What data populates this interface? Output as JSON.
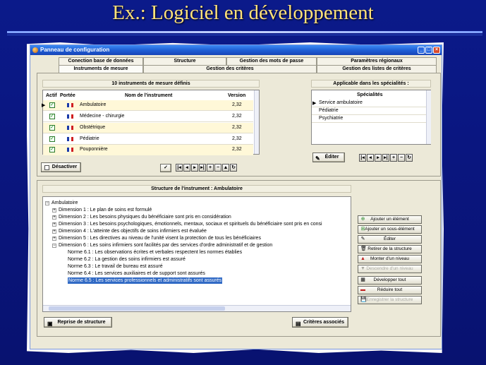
{
  "slide": {
    "title": "Ex.: Logiciel en développement"
  },
  "window": {
    "title": "Panneau de configuration",
    "min": "_",
    "max": "□",
    "close": "×"
  },
  "tabs_top": [
    "Conection base de données",
    "Structure",
    "Gestion des mots de passe",
    "Paramètres régionaux"
  ],
  "tabs_bottom": [
    "Instruments de mesure",
    "Gestion des critères",
    "Gestion des listes de critères"
  ],
  "instruments": {
    "title": "10 instruments de mesure définis",
    "headers": {
      "actif": "Actif",
      "portee": "Portée",
      "nom": "Nom de l'instrument",
      "version": "Version"
    },
    "rows": [
      {
        "name": "Ambulatoire",
        "version": "2,32"
      },
      {
        "name": "Médecine - chirurgie",
        "version": "2,32"
      },
      {
        "name": "Obstétrique",
        "version": "2,32"
      },
      {
        "name": "Pédiatrie",
        "version": "2,32"
      },
      {
        "name": "Pouponnière",
        "version": "2,32"
      }
    ],
    "deactivate_label": "Désactiver"
  },
  "specialties": {
    "title": "Applicable dans les spécialités :",
    "header": "Spécialités",
    "items": [
      "Service ambulatoire",
      "Pédiatrie",
      "Psychiatrie"
    ],
    "edit_label": "Éditer"
  },
  "nav_glyphs": {
    "first": "|◂",
    "prev": "◂",
    "next": "▸",
    "last": "▸|",
    "add": "+",
    "remove": "−",
    "up": "▲",
    "refresh": "↻",
    "ok": "✓"
  },
  "structure": {
    "title": "Structure de l'instrument : Ambulatoire",
    "root": "Ambulatoire",
    "dimensions": [
      "Dimension 1 : Le plan de soins est formulé",
      "Dimension 2 : Les besoins physiques du bénéficiaire sont pris en considération",
      "Dimension 3 : Les besoins psychologiques, émotionnels, mentaux, sociaux et spirituels du bénéficiaire sont pris en consi",
      "Dimension 4 : L'atteinte des objectifs de soins infirmiers est évaluée",
      "Dimension 5 : Les directives au niveau de l'unité visent la protection de tous les bénéficiaires",
      "Dimension 6 : Les soins infirmiers sont facilités par des services d'ordre administratif et de gestion"
    ],
    "normes": [
      "Norme 6.1 : Les observations écrites et verbales respectent les normes établies",
      "Norme 6.2 : La gestion des soins infirmiers est assuré",
      "Norme 6.3 : Le travail de bureau est assuré",
      "Norme 6.4 : Les services auxiliaires et de support sont assurés",
      "Norme 6.5 : Les services professionnels et administratifs sont assurés"
    ],
    "actions": [
      "Ajouter un élément",
      "Ajouter un sous-élément",
      "Éditer",
      "Retirer de la structure",
      "Monter d'un niveau",
      "Descendre d'un niveau",
      "Développer tout",
      "Réduire tout",
      "Enregistrer la structure"
    ],
    "reprise_label": "Reprise de structure",
    "criteres_label": "Critères associés"
  },
  "colors": {
    "accent": "#316ac5",
    "title_gold": "#ffe27a",
    "background": "#0a1680"
  }
}
